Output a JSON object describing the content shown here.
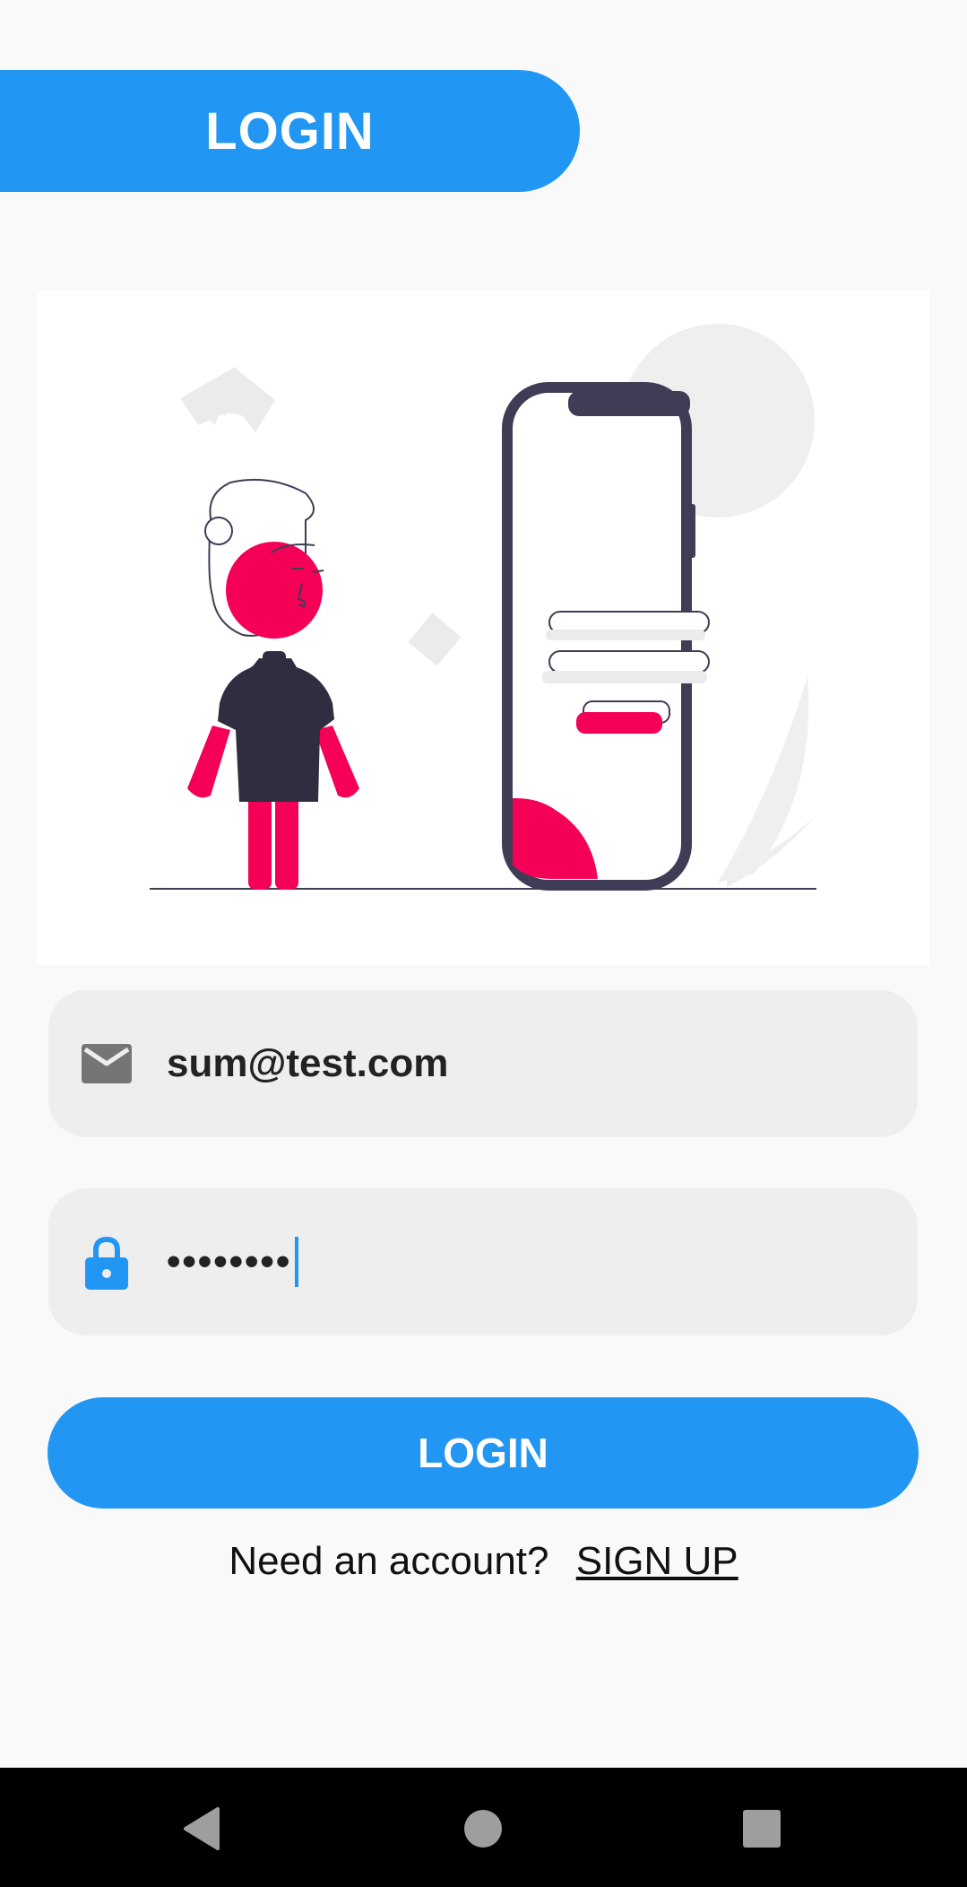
{
  "header": {
    "title": "LOGIN"
  },
  "illustration": {
    "description_icon": "person-with-phone-illustration"
  },
  "email_field": {
    "icon": "mail-icon",
    "value": "sum@test.com"
  },
  "password_field": {
    "icon": "lock-icon",
    "value": "••••••••"
  },
  "login_button": {
    "label": "LOGIN"
  },
  "signup": {
    "prompt": "Need an account?",
    "link_label": "SIGN UP"
  },
  "navbar": {
    "back_icon": "back-triangle-icon",
    "home_icon": "home-circle-icon",
    "recents_icon": "recents-square-icon"
  },
  "colors": {
    "primary": "#2196f3",
    "accent": "#f50057",
    "dark": "#3f3d56",
    "field_bg": "#eeeeef",
    "page_bg": "#f9f9fa"
  }
}
